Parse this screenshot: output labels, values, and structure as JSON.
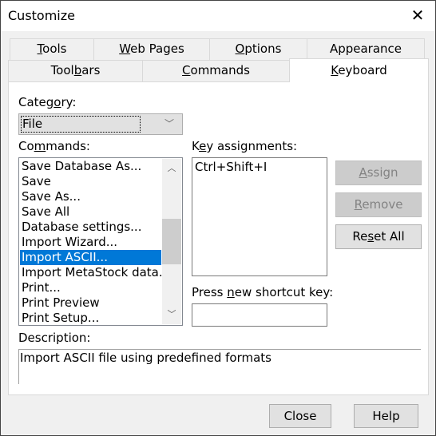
{
  "window": {
    "title": "Customize",
    "close_icon": "close-icon"
  },
  "tabs_row1": [
    {
      "label": "Tools",
      "accel": 0
    },
    {
      "label": "Web Pages",
      "accel": 0
    },
    {
      "label": "Options",
      "accel": 0
    },
    {
      "label": "Appearance",
      "accel": -1
    }
  ],
  "tabs_row2": [
    {
      "label": "Toolbars",
      "accel": 4
    },
    {
      "label": "Commands",
      "accel": 0
    },
    {
      "label": "Keyboard",
      "accel": 0,
      "selected": true
    }
  ],
  "category": {
    "label": "Category:",
    "accel": 5,
    "value": "File"
  },
  "commands": {
    "label": "Commands:",
    "accel": 2,
    "items": [
      "Save Database As...",
      "Save",
      "Save As...",
      "Save All",
      "Database settings...",
      "Import Wizard...",
      "Import ASCII...",
      "Import MetaStock data...",
      "Print...",
      "Print Preview",
      "Print Setup..."
    ],
    "selected": "Import ASCII...",
    "scroll_position_fraction": 0.5
  },
  "key_assignments": {
    "label": "Key assignments:",
    "accel": 1,
    "items": [
      "Ctrl+Shift+I"
    ]
  },
  "shortcut": {
    "label": "Press new shortcut key:",
    "accel": 6,
    "value": ""
  },
  "buttons": {
    "assign": {
      "label": "Assign",
      "accel": 0,
      "disabled": true
    },
    "remove": {
      "label": "Remove",
      "accel": 0,
      "disabled": true
    },
    "reset_all": {
      "label": "Reset All",
      "accel": 2,
      "disabled": false
    },
    "close": {
      "label": "Close"
    },
    "help": {
      "label": "Help"
    }
  },
  "description": {
    "label": "Description:",
    "text": "Import ASCII file using predefined formats"
  },
  "colors": {
    "selection": "#0078d7"
  }
}
